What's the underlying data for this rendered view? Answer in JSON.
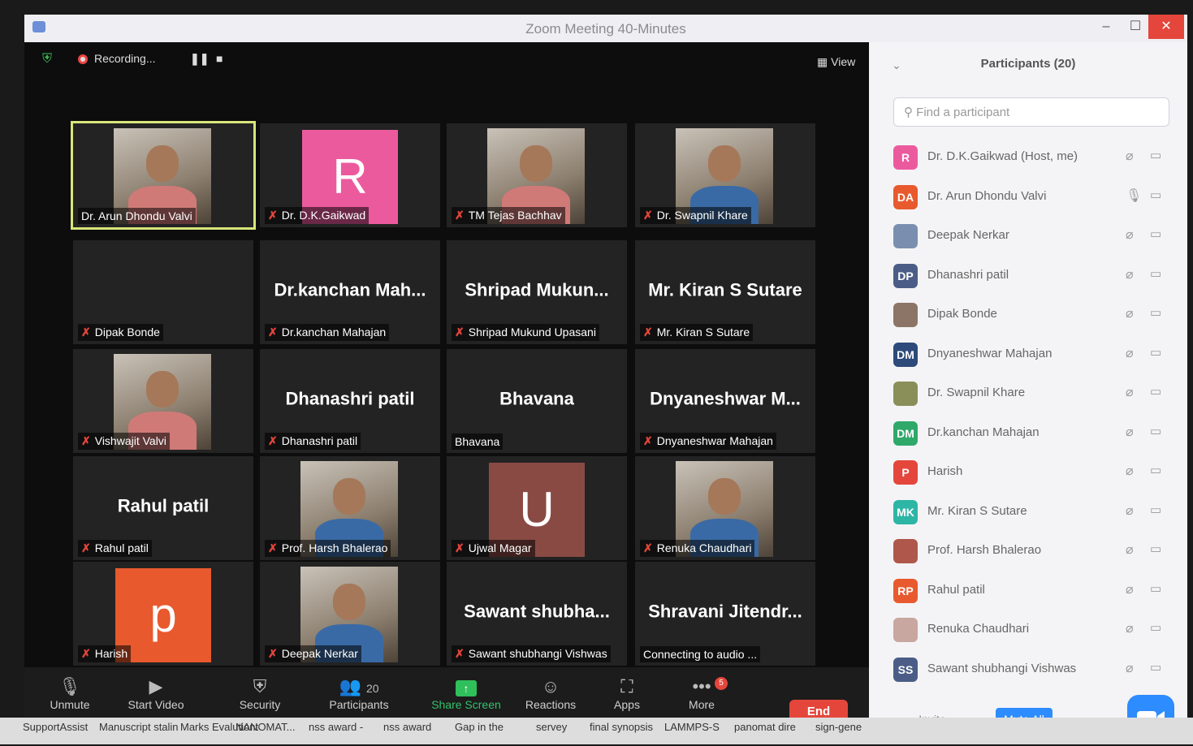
{
  "window": {
    "title": "Zoom Meeting 40-Minutes",
    "controls": [
      "–",
      "☐",
      "✕"
    ]
  },
  "topbar": {
    "recording": "Recording...",
    "view": "View"
  },
  "tiles": [
    {
      "name": "Dr. Arun Dhondu Valvi",
      "big": "",
      "muted": false,
      "kind": "photo"
    },
    {
      "name": "Dr. D.K.Gaikwad",
      "big": "",
      "muted": true,
      "kind": "avatar",
      "letter": "R",
      "color": "#ec5a9e"
    },
    {
      "name": "TM Tejas Bachhav",
      "big": "",
      "muted": true,
      "kind": "photo"
    },
    {
      "name": "Dr. Swapnil Khare",
      "big": "",
      "muted": true,
      "kind": "photo"
    },
    {
      "name": "Dipak Bonde",
      "big": "",
      "muted": true,
      "kind": "none"
    },
    {
      "name": "Dr.kanchan Mahajan",
      "big": "Dr.kanchan  Mah...",
      "muted": true,
      "kind": "none"
    },
    {
      "name": "Shripad Mukund Upasani",
      "big": "Shripad  Mukun...",
      "muted": true,
      "kind": "none"
    },
    {
      "name": "Mr. Kiran S Sutare",
      "big": "Mr. Kiran S Sutare",
      "muted": true,
      "kind": "none"
    },
    {
      "name": "Vishwajit Valvi",
      "big": "",
      "muted": true,
      "kind": "photo"
    },
    {
      "name": "Dhanashri patil",
      "big": "Dhanashri patil",
      "muted": true,
      "kind": "none"
    },
    {
      "name": "Bhavana",
      "big": "Bhavana",
      "muted": false,
      "kind": "none"
    },
    {
      "name": "Dnyaneshwar Mahajan",
      "big": "Dnyaneshwar  M...",
      "muted": true,
      "kind": "none"
    },
    {
      "name": "Rahul patil",
      "big": "Rahul patil",
      "muted": true,
      "kind": "none"
    },
    {
      "name": "Prof. Harsh Bhalerao",
      "big": "",
      "muted": true,
      "kind": "photo"
    },
    {
      "name": "Ujwal Magar",
      "big": "",
      "muted": true,
      "kind": "avatar",
      "letter": "U",
      "color": "#8a4a44"
    },
    {
      "name": "Renuka Chaudhari",
      "big": "",
      "muted": true,
      "kind": "photo"
    },
    {
      "name": "Harish",
      "big": "",
      "muted": true,
      "kind": "avatar",
      "letter": "p",
      "color": "#e8592e"
    },
    {
      "name": "Deepak Nerkar",
      "big": "",
      "muted": true,
      "kind": "photo"
    },
    {
      "name": "Sawant shubhangi Vishwas",
      "big": "Sawant  shubha...",
      "muted": true,
      "kind": "none"
    },
    {
      "name": "Connecting to audio ...",
      "big": "Shravani  Jitendr...",
      "muted": false,
      "kind": "none"
    }
  ],
  "toolbar": {
    "unmute": "Unmute",
    "start_video": "Start Video",
    "security": "Security",
    "participants": "Participants",
    "participants_count": "20",
    "share_screen": "Share Screen",
    "reactions": "Reactions",
    "apps": "Apps",
    "more": "More",
    "more_badge": "5",
    "end": "End"
  },
  "panel": {
    "title": "Participants (20)",
    "search_placeholder": "Find a participant",
    "invite": "Invite",
    "mute_all": "Mute All",
    "participants": [
      {
        "initials": "R",
        "name": "Dr. D.K.Gaikwad (Host, me)",
        "color": "#ec5a9e",
        "photo": false
      },
      {
        "initials": "DA",
        "name": "Dr. Arun Dhondu Valvi",
        "color": "#e8592e",
        "photo": false
      },
      {
        "initials": "",
        "name": "Deepak Nerkar",
        "color": "#7a8fb0",
        "photo": true
      },
      {
        "initials": "DP",
        "name": "Dhanashri patil",
        "color": "#4b5d87",
        "photo": false
      },
      {
        "initials": "",
        "name": "Dipak Bonde",
        "color": "#8c7566",
        "photo": true
      },
      {
        "initials": "DM",
        "name": "Dnyaneshwar Mahajan",
        "color": "#2e4a7a",
        "photo": false
      },
      {
        "initials": "",
        "name": "Dr. Swapnil Khare",
        "color": "#8a8f5a",
        "photo": true
      },
      {
        "initials": "DM",
        "name": "Dr.kanchan Mahajan",
        "color": "#2fa86a",
        "photo": false
      },
      {
        "initials": "P",
        "name": "Harish",
        "color": "#e5463b",
        "photo": false
      },
      {
        "initials": "MK",
        "name": "Mr. Kiran S Sutare",
        "color": "#2db5a5",
        "photo": false
      },
      {
        "initials": "",
        "name": "Prof. Harsh Bhalerao",
        "color": "#b0574c",
        "photo": true
      },
      {
        "initials": "RP",
        "name": "Rahul patil",
        "color": "#e8592e",
        "photo": false
      },
      {
        "initials": "",
        "name": "Renuka Chaudhari",
        "color": "#c8a7a0",
        "photo": true
      },
      {
        "initials": "SS",
        "name": "Sawant shubhangi Vishwas",
        "color": "#4b5d87",
        "photo": false
      }
    ]
  },
  "taskbar": [
    "SupportAssist",
    "Manuscript stalin",
    "Marks Evalutiont",
    "NANOMAT...",
    "nss award -",
    "nss award",
    "Gap in the",
    "servey",
    "final synopsis",
    "LAMMPS-S",
    "panomat dire",
    "sign-gene"
  ]
}
